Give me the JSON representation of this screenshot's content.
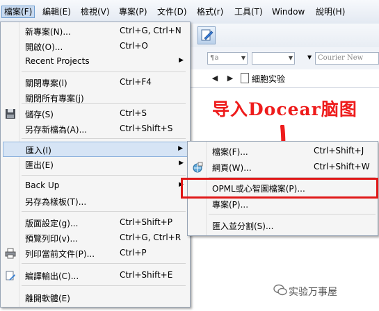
{
  "menubar": {
    "items": [
      {
        "label": "檔案(F)"
      },
      {
        "label": "編輯(E)"
      },
      {
        "label": "檢視(V)"
      },
      {
        "label": "專案(P)"
      },
      {
        "label": "文件(D)"
      },
      {
        "label": "格式(r)"
      },
      {
        "label": "工具(T)"
      },
      {
        "label": "Window"
      },
      {
        "label": "說明(H)"
      }
    ]
  },
  "format_bar": {
    "style_combo": "¶a",
    "font_combo": "Courier New"
  },
  "nav": {
    "back_icon": "left-arrow",
    "forward_icon": "right-arrow",
    "title": "細胞实验"
  },
  "file_menu": {
    "items": [
      {
        "label": "新專案(N)...",
        "shortcut": "Ctrl+G, Ctrl+N"
      },
      {
        "label": "開啟(O)...",
        "shortcut": "Ctrl+O"
      },
      {
        "label": "Recent Projects",
        "shortcut": ""
      },
      {
        "label": "關閉專案(l)",
        "shortcut": "Ctrl+F4"
      },
      {
        "label": "關閉所有專案(j)",
        "shortcut": ""
      },
      {
        "label": "儲存(S)",
        "shortcut": "Ctrl+S"
      },
      {
        "label": "另存新檔為(A)...",
        "shortcut": "Ctrl+Shift+S"
      },
      {
        "label": "匯入(I)",
        "shortcut": ""
      },
      {
        "label": "匯出(E)",
        "shortcut": ""
      },
      {
        "label": "Back Up",
        "shortcut": ""
      },
      {
        "label": "另存為樣板(T)...",
        "shortcut": ""
      },
      {
        "label": "版面設定(g)...",
        "shortcut": "Ctrl+Shift+P"
      },
      {
        "label": "預覽列印(v)...",
        "shortcut": "Ctrl+G, Ctrl+R"
      },
      {
        "label": "列印當前文件(P)...",
        "shortcut": "Ctrl+P"
      },
      {
        "label": "編譯輸出(C)...",
        "shortcut": "Ctrl+Shift+E"
      },
      {
        "label": "離開軟體(E)",
        "shortcut": ""
      }
    ]
  },
  "import_submenu": {
    "items": [
      {
        "label": "檔案(F)...",
        "shortcut": "Ctrl+Shift+J"
      },
      {
        "label": "網頁(W)...",
        "shortcut": "Ctrl+Shift+W"
      },
      {
        "label": "OPML或心智圖檔案(P)...",
        "shortcut": ""
      },
      {
        "label": "專案(P)...",
        "shortcut": ""
      },
      {
        "label": "匯入並分割(S)...",
        "shortcut": ""
      }
    ]
  },
  "annotation": {
    "text": "导入Docear脑图",
    "color": "#ee1c1c"
  },
  "watermark": {
    "text": "实验万事屋"
  },
  "colors": {
    "highlight_box": "#e01818",
    "menu_highlight": "#d6e4f5"
  }
}
